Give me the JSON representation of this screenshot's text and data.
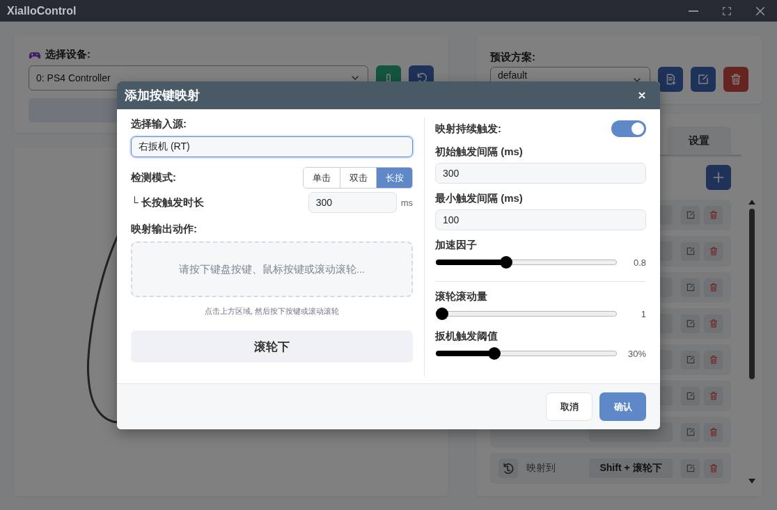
{
  "window": {
    "title": "XialloControl"
  },
  "device": {
    "label": "选择设备:",
    "selected": "0: PS4 Controller"
  },
  "preset": {
    "label": "预设方案:",
    "selected": "default"
  },
  "tabs": [
    {
      "label": "设置",
      "selected": false
    }
  ],
  "mappings": [
    {
      "kind": "covered"
    },
    {
      "kind": "covered"
    },
    {
      "kind": "covered"
    },
    {
      "kind": "covered"
    },
    {
      "kind": "covered"
    },
    {
      "kind": "covered"
    },
    {
      "kind": "covered"
    },
    {
      "kind": "full",
      "action": "映射到",
      "keys": "Shift + 滚轮下"
    }
  ],
  "dialog": {
    "title": "添加按键映射",
    "input_source": {
      "label": "选择输入源:",
      "value": "右扳机 (RT)"
    },
    "detect_mode": {
      "label": "检测模式:",
      "options": [
        {
          "label": "单击",
          "selected": false
        },
        {
          "label": "双击",
          "selected": false
        },
        {
          "label": "长按",
          "selected": true
        }
      ]
    },
    "hold_duration": {
      "label": "└ 长按触发时长",
      "value": "300",
      "unit": "ms"
    },
    "output": {
      "label": "映射输出动作:",
      "placeholder": "请按下键盘按键、鼠标按键或滚动滚轮...",
      "hint": "点击上方区域, 然后按下按键或滚动滚轮",
      "current": "滚轮下"
    },
    "repeat": {
      "label": "映射持续触发:",
      "on": true
    },
    "intervals": [
      {
        "label": "初始触发间隔 (ms)",
        "value": "300"
      },
      {
        "label": "最小触发间隔 (ms)",
        "value": "100"
      }
    ],
    "sliders": [
      {
        "label": "加速因子",
        "level": 0.38,
        "reading": "0.8",
        "divider_after": true
      },
      {
        "label": "滚轮滚动量",
        "level": 0,
        "reading": "1",
        "divider_after": false
      },
      {
        "label": "扳机触发阈值",
        "level": 0.31,
        "reading": "30%",
        "divider_after": false
      }
    ],
    "buttons": [
      {
        "label": "取消",
        "kind": "secondary"
      },
      {
        "label": "确认",
        "kind": "primary"
      }
    ]
  }
}
